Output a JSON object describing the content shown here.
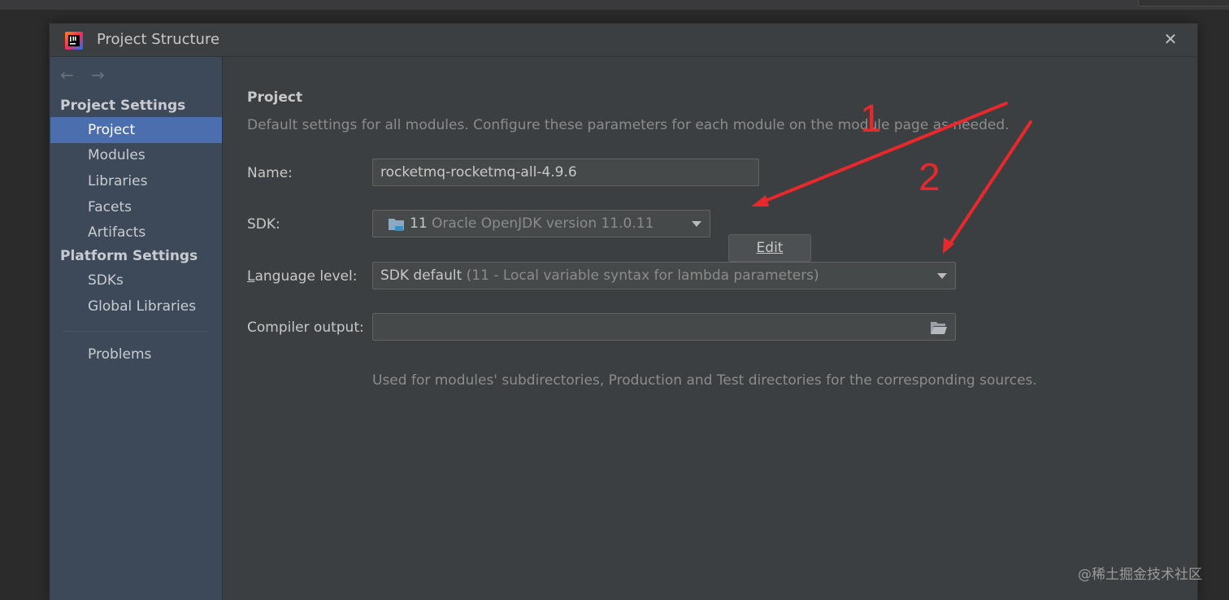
{
  "dialog": {
    "title": "Project Structure",
    "close_icon": "close-icon"
  },
  "sidebar": {
    "nav": {
      "back_icon": "arrow-left-icon",
      "forward_icon": "arrow-right-icon"
    },
    "project_settings_header": "Project Settings",
    "project_settings_items": [
      "Project",
      "Modules",
      "Libraries",
      "Facets",
      "Artifacts"
    ],
    "platform_settings_header": "Platform Settings",
    "platform_settings_items": [
      "SDKs",
      "Global Libraries"
    ],
    "problems_label": "Problems",
    "selected_item": "Project"
  },
  "content": {
    "title": "Project",
    "description": "Default settings for all modules. Configure these parameters for each module on the module page as needed.",
    "name": {
      "label": "Name:",
      "value": "rocketmq-rocketmq-all-4.9.6"
    },
    "sdk": {
      "label": "SDK:",
      "version": "11",
      "detail": "Oracle OpenJDK version 11.0.11",
      "edit_label": "Edit",
      "icon": "folder-sdk-icon"
    },
    "language_level": {
      "label_prefix": "L",
      "label_rest": "anguage level:",
      "value_main": "SDK default",
      "value_detail": "(11 - Local variable syntax for lambda parameters)"
    },
    "compiler_output": {
      "label": "Compiler output:",
      "value": "",
      "browse_icon": "folder-open-icon",
      "hint": "Used for modules' subdirectories, Production and Test directories for the corresponding sources."
    }
  },
  "annotations": {
    "label_1": "1",
    "label_2": "2",
    "color": "#e8282b"
  },
  "watermark": "@稀土掘金技术社区",
  "colors": {
    "accent": "#4b6eaf",
    "sidebar": "#3d4958",
    "panel": "#3c3f41",
    "background": "#2b2b2b"
  }
}
